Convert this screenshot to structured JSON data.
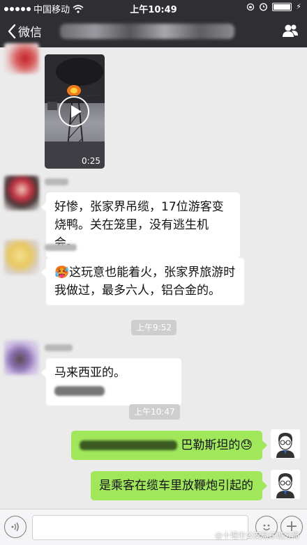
{
  "status_bar": {
    "carrier": "中国移动",
    "time": "上午10:49"
  },
  "nav": {
    "back_label": "微信"
  },
  "messages": [
    {
      "type": "video",
      "duration": "0:25"
    },
    {
      "type": "text",
      "text": "好惨，张家界吊缆，17位游客变烧鸭。关在笼里，没有逃生机会。"
    },
    {
      "type": "text",
      "emoji": "🥵",
      "text": "这玩意也能着火，张家界旅游时我做过，最多六人，铝合金的。"
    },
    {
      "type": "timestamp",
      "text": "上午9:52"
    },
    {
      "type": "text",
      "text": "马来西亚的。"
    },
    {
      "type": "timestamp",
      "text": "上午10:47"
    },
    {
      "type": "text",
      "text": "巴勒斯坦的",
      "emoji": "😓"
    },
    {
      "type": "text",
      "text": "是乘客在缆车里放鞭炮引起的"
    }
  ],
  "input": {
    "add_symbol": "+"
  },
  "watermark": "@十堰市公安局东城分局",
  "colors": {
    "nav_bg": "#2e2e33",
    "chat_bg": "#ebebeb",
    "sent_bubble": "#a0e75a"
  },
  "icons": [
    "signal-dots-icon",
    "wifi-icon",
    "alarm-icon",
    "battery-icon",
    "back-chevron-icon",
    "contacts-icon",
    "play-icon",
    "voice-icon",
    "emoji-icon",
    "add-icon"
  ]
}
